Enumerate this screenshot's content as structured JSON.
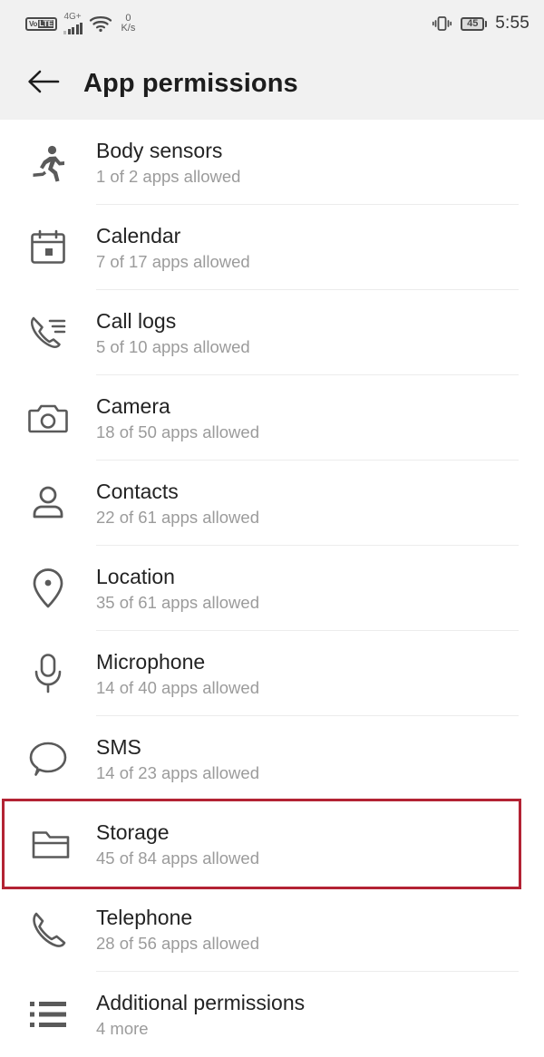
{
  "status_bar": {
    "volte_prefix": "Vo",
    "volte_suffix": "LTE",
    "network_label": "4G+",
    "net_speed_value": "0",
    "net_speed_unit": "K/s",
    "battery_level": "45",
    "time": "5:55",
    "icons": {
      "vibrate": "vibrate-icon",
      "wifi": "wifi-icon",
      "signal": "signal-bars-icon",
      "battery": "battery-icon"
    }
  },
  "app_bar": {
    "back_label": "back-arrow",
    "title": "App permissions"
  },
  "permissions": [
    {
      "icon": "body-sensors-icon",
      "title": "Body sensors",
      "subtitle": "1 of 2 apps allowed",
      "highlighted": false
    },
    {
      "icon": "calendar-icon",
      "title": "Calendar",
      "subtitle": "7 of 17 apps allowed",
      "highlighted": false
    },
    {
      "icon": "call-logs-icon",
      "title": "Call logs",
      "subtitle": "5 of 10 apps allowed",
      "highlighted": false
    },
    {
      "icon": "camera-icon",
      "title": "Camera",
      "subtitle": "18 of 50 apps allowed",
      "highlighted": false
    },
    {
      "icon": "contacts-icon",
      "title": "Contacts",
      "subtitle": "22 of 61 apps allowed",
      "highlighted": false
    },
    {
      "icon": "location-pin-icon",
      "title": "Location",
      "subtitle": "35 of 61 apps allowed",
      "highlighted": false
    },
    {
      "icon": "microphone-icon",
      "title": "Microphone",
      "subtitle": "14 of 40 apps allowed",
      "highlighted": false
    },
    {
      "icon": "sms-bubble-icon",
      "title": "SMS",
      "subtitle": "14 of 23 apps allowed",
      "highlighted": false
    },
    {
      "icon": "folder-icon",
      "title": "Storage",
      "subtitle": "45 of 84 apps allowed",
      "highlighted": true
    },
    {
      "icon": "telephone-icon",
      "title": "Telephone",
      "subtitle": "28 of 56 apps allowed",
      "highlighted": false
    },
    {
      "icon": "additional-permissions-icon",
      "title": "Additional permissions",
      "subtitle": "4 more",
      "highlighted": false
    }
  ],
  "colors": {
    "header_bg": "#f1f1f1",
    "title_text": "#232323",
    "subtitle_text": "#9b9b9b",
    "icon": "#5a5a5a",
    "highlight_border": "#b32334",
    "divider": "#ececec"
  }
}
